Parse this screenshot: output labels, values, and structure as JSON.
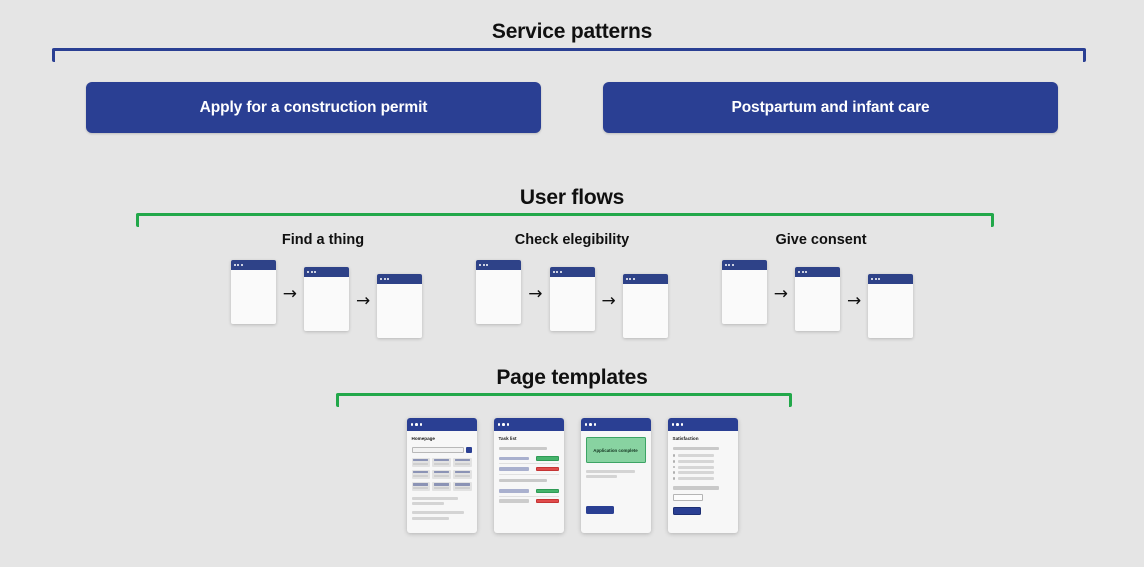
{
  "sections": {
    "service_patterns": {
      "title": "Service patterns",
      "bracket_color": "#2a3f93",
      "patterns": [
        {
          "label": "Apply for a construction permit"
        },
        {
          "label": "Postpartum and infant care"
        }
      ]
    },
    "user_flows": {
      "title": "User flows",
      "bracket_color": "#22a84a",
      "flows": [
        {
          "label": "Find a thing",
          "steps": 3
        },
        {
          "label": "Check elegibility",
          "steps": 3
        },
        {
          "label": "Give consent",
          "steps": 3
        }
      ]
    },
    "page_templates": {
      "title": "Page templates",
      "bracket_color": "#22a84a",
      "templates": [
        {
          "name": "homepage",
          "title": "Homepage",
          "kind": "homepage",
          "card_count": 9
        },
        {
          "name": "task-list",
          "title": "Task list",
          "kind": "tasklist",
          "rows": [
            {
              "status": "green"
            },
            {
              "status": "red"
            },
            {
              "status": "green"
            },
            {
              "status": "red"
            }
          ]
        },
        {
          "name": "application-complete",
          "title": "Application complete",
          "kind": "confirmation",
          "banner_label": "Application complete",
          "banner_color": "#88d3a1",
          "button_color": "#2a3f93"
        },
        {
          "name": "satisfaction",
          "title": "Satisfaction",
          "kind": "satisfaction",
          "option_count": 5,
          "button_color": "#2a3f93"
        }
      ]
    }
  },
  "icons": {
    "arrow": "→",
    "window_dot": "window-dot"
  },
  "theme": {
    "background": "#e5e5e5",
    "brand_blue": "#2a3f93",
    "brand_green": "#22a84a",
    "text": "#101010"
  }
}
